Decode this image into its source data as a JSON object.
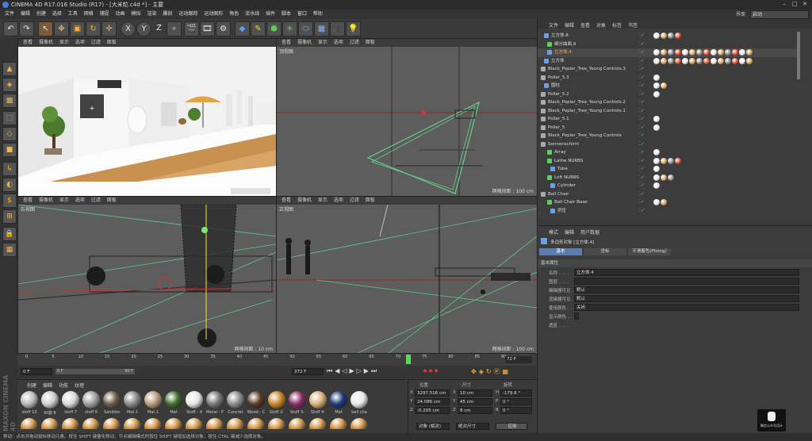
{
  "window": {
    "title": "CINEMA 4D R17.016 Studio (R17) - [大米粒.c4d *] - 主要"
  },
  "menu": [
    "文件",
    "编辑",
    "创建",
    "选择",
    "工具",
    "网格",
    "捕捉",
    "动画",
    "模拟",
    "渲染",
    "雕刻",
    "运动跟踪",
    "运动图形",
    "角色",
    "流水线",
    "插件",
    "脚本",
    "窗口",
    "帮助"
  ],
  "layout": {
    "label": "界面",
    "value": "启动"
  },
  "viewports": {
    "menu": [
      "查看",
      "摄像机",
      "显示",
      "选项",
      "过滤",
      "面板"
    ],
    "top_right": {
      "name": "顶视图",
      "grid": "网格间距 : 100 cm"
    },
    "bottom_left": {
      "name": "右视图",
      "grid": "网格间距 : 10 cm"
    },
    "bottom_right": {
      "name": "正视图",
      "grid": "网格间距 : 100 cm"
    }
  },
  "timeline": {
    "ticks": [
      "0",
      "5",
      "10",
      "15",
      "20",
      "25",
      "30",
      "35",
      "40",
      "45",
      "50",
      "55",
      "60",
      "65",
      "70",
      "72",
      "75",
      "80",
      "85",
      "90"
    ],
    "current": "72 F",
    "start": "0 F",
    "min": "0 F",
    "max": "90 F",
    "end": "372 F"
  },
  "materials": {
    "menu": [
      "创建",
      "编辑",
      "功能",
      "纹理"
    ],
    "row1": [
      {
        "label": "stoff 10",
        "color": "#b9b9b9"
      },
      {
        "label": "Kt旋 8",
        "color": "#cfcfcf"
      },
      {
        "label": "stoff 7",
        "color": "#d8d8d8"
      },
      {
        "label": "stoff 6",
        "color": "#9e9e9e"
      },
      {
        "label": "Sandsto",
        "color": "#6b5a4a"
      },
      {
        "label": "Mat.1",
        "color": "#888888"
      },
      {
        "label": "Mat.1",
        "color": "#b89b7a"
      },
      {
        "label": "Mat",
        "color": "#3d6b2f"
      },
      {
        "label": "Stoff - 9",
        "color": "#e6e6e6"
      },
      {
        "label": "Metal - P",
        "color": "#777777"
      },
      {
        "label": "Concret",
        "color": "#8a8a8a"
      },
      {
        "label": "Wood - C",
        "color": "#5b3a26"
      },
      {
        "label": "Stoff 2-",
        "color": "#c9862a"
      },
      {
        "label": "Stoff 3-",
        "color": "#8a2e62"
      },
      {
        "label": "Stoff 4-",
        "color": "#d6b27a"
      },
      {
        "label": "Mat",
        "color": "#1f3a78"
      },
      {
        "label": "ball cha",
        "color": "#e8e8e8"
      }
    ]
  },
  "coords": {
    "headers": [
      "位置",
      "尺寸",
      "旋转"
    ],
    "rows": [
      {
        "a": "X",
        "pos": "3297.516 cm",
        "b": "X",
        "size": "10 cm",
        "c": "H",
        "rot": "-179.6 °"
      },
      {
        "a": "Y",
        "pos": "24.086 cm",
        "b": "Y",
        "size": "45 cm",
        "c": "P",
        "rot": "0 °"
      },
      {
        "a": "Z",
        "pos": "-0.205 cm",
        "b": "Z",
        "size": "8 cm",
        "c": "B",
        "rot": "0 °"
      }
    ],
    "mode1": "对象 (相对)",
    "mode2": "绝对尺寸",
    "apply": "应用"
  },
  "objmgr": {
    "menu": [
      "文件",
      "编辑",
      "查看",
      "对象",
      "标签",
      "书签"
    ],
    "rows": [
      {
        "name": "立方体.8",
        "color": "#ddd"
      },
      {
        "name": "细分曲面.9",
        "color": "#ddd"
      },
      {
        "name": "立方体.4",
        "color": "#ffb13b"
      },
      {
        "name": "立方体",
        "color": "#ddd"
      },
      {
        "name": "Black_Poplar_Tree_Young Controls.3",
        "color": "#ddd"
      },
      {
        "name": "Poller_5.3",
        "color": "#ddd"
      },
      {
        "name": "圆柱",
        "color": "#ddd"
      },
      {
        "name": "Poller_5.2",
        "color": "#ddd"
      },
      {
        "name": "Black_Poplar_Tree_Young Controls.2",
        "color": "#ddd"
      },
      {
        "name": "Black_Poplar_Tree_Young Controls.1",
        "color": "#ddd"
      },
      {
        "name": "Poller_5.1",
        "color": "#ddd"
      },
      {
        "name": "Poller_5",
        "color": "#ddd"
      },
      {
        "name": "Black_Poplar_Tree_Young Controls",
        "color": "#ddd"
      },
      {
        "name": "Sonnenschirm",
        "color": "#ddd"
      },
      {
        "name": "Array",
        "color": "#ddd"
      },
      {
        "name": "Lathe NURBS",
        "color": "#ddd"
      },
      {
        "name": "Tube",
        "color": "#ddd"
      },
      {
        "name": "Loft NURBS",
        "color": "#ddd"
      },
      {
        "name": "Cylinder",
        "color": "#ddd"
      },
      {
        "name": "Ball Chair",
        "color": "#ddd"
      },
      {
        "name": "Ball Chair Base",
        "color": "#ddd"
      },
      {
        "name": "挤压",
        "color": "#ddd"
      }
    ]
  },
  "attmgr": {
    "menu": [
      "模式",
      "编辑",
      "用户数据"
    ],
    "object": "多边形对象 [立方体.4]",
    "tabs": [
      "基本",
      "坐标",
      "平滑着色(Phong)"
    ],
    "section": "基本属性",
    "fields": [
      {
        "label": "名称",
        "value": "立方体.4"
      },
      {
        "label": "图层",
        "value": ""
      },
      {
        "label": "编辑器可见",
        "value": "默认"
      },
      {
        "label": "渲染器可见",
        "value": "默认"
      },
      {
        "label": "使用颜色",
        "value": "关闭"
      },
      {
        "label": "显示颜色",
        "value": ""
      },
      {
        "label": "透显",
        "value": ""
      }
    ]
  },
  "status": "移动：点击并拖动鼠标移动元素。按住 SHIFT 键量化移动；节点编辑模式时按住 SHIFT 键增加选择对象；按住 CTRL 键减少选择对象。",
  "watermark": "微信公众号设计"
}
